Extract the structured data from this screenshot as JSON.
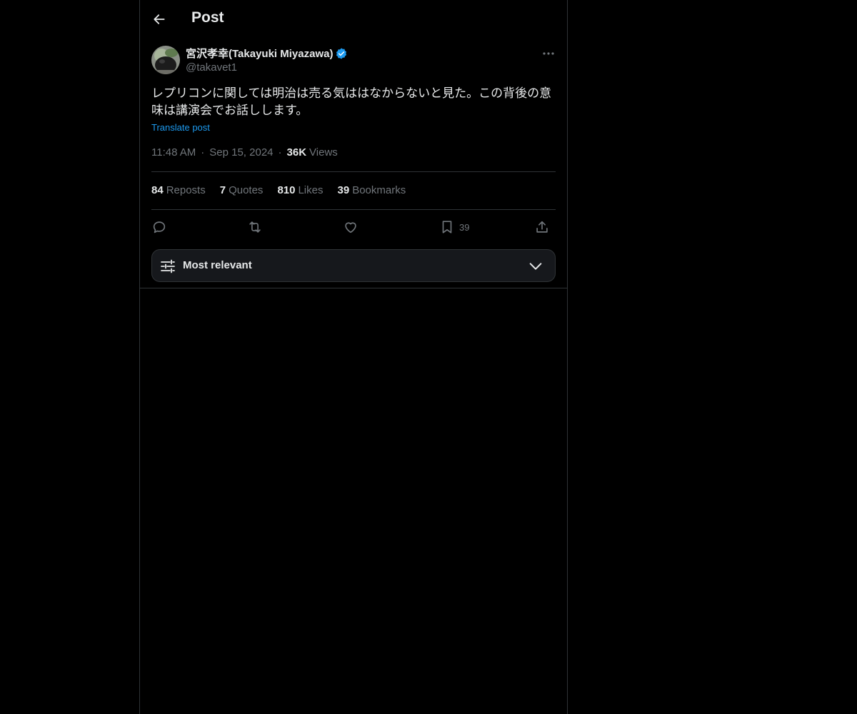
{
  "header": {
    "title": "Post",
    "back_icon": "arrow-left-icon"
  },
  "author": {
    "name": "宮沢孝幸(Takayuki Miyazawa)",
    "handle": "@takavet1",
    "verified": true,
    "verified_color": "#1d9bf0"
  },
  "post": {
    "text": "レプリコンに関しては明治は売る気ははなからないと見た。この背後の意味は講演会でお話しします。",
    "translate_label": "Translate post",
    "time": "11:48 AM",
    "date": "Sep 15, 2024",
    "views_count": "36K",
    "views_label": "Views",
    "meta_separator": "·"
  },
  "stats": {
    "reposts": {
      "count": "84",
      "label": "Reposts"
    },
    "quotes": {
      "count": "7",
      "label": "Quotes"
    },
    "likes": {
      "count": "810",
      "label": "Likes"
    },
    "bookmarks": {
      "count": "39",
      "label": "Bookmarks"
    }
  },
  "actions": {
    "reply_icon": "reply-icon",
    "repost_icon": "repost-icon",
    "like_icon": "heart-icon",
    "bookmark_icon": "bookmark-icon",
    "bookmark_count": "39",
    "share_icon": "share-icon"
  },
  "sort": {
    "label": "Most relevant",
    "icon": "sliders-icon",
    "chevron": "chevron-down-icon"
  },
  "colors": {
    "background": "#000000",
    "text_primary": "#e7e9ea",
    "text_secondary": "#71767b",
    "accent": "#1d9bf0",
    "border": "#2f3336",
    "surface": "#16181c"
  }
}
